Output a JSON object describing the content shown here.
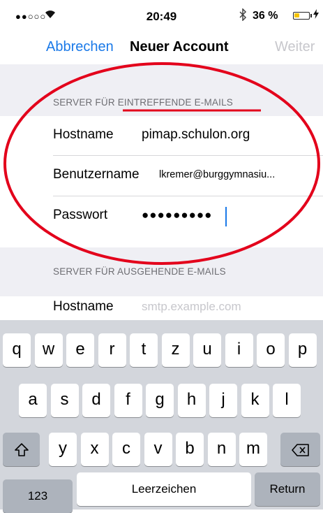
{
  "status_bar": {
    "signal": "●●○○○",
    "wifi_icon": "wifi-icon",
    "time": "20:49",
    "bluetooth_icon": "bluetooth-icon",
    "battery_text": "36 %",
    "battery_level": 0.36,
    "battery_color": "#f5c300"
  },
  "nav": {
    "cancel": "Abbrechen",
    "title": "Neuer Account",
    "next": "Weiter"
  },
  "incoming": {
    "section_title": "SERVER FÜR EINTREFFENDE E-MAILS",
    "hostname_label": "Hostname",
    "hostname_value": "pimap.schulon.org",
    "username_label": "Benutzername",
    "username_value": "lkremer@burggymnasiu...",
    "password_label": "Passwort",
    "password_value": "●●●●●●●●●"
  },
  "outgoing": {
    "section_title": "SERVER FÜR AUSGEHENDE E-MAILS",
    "hostname_label": "Hostname",
    "hostname_placeholder": "smtp.example.com"
  },
  "keyboard": {
    "row1": [
      "q",
      "w",
      "e",
      "r",
      "t",
      "z",
      "u",
      "i",
      "o",
      "p"
    ],
    "row2": [
      "a",
      "s",
      "d",
      "f",
      "g",
      "h",
      "j",
      "k",
      "l"
    ],
    "row3": [
      "y",
      "x",
      "c",
      "v",
      "b",
      "n",
      "m"
    ],
    "shift_icon": "shift-icon",
    "delete_icon": "delete-icon",
    "numbers": "123",
    "space": "Leerzeichen",
    "return": "Return"
  },
  "colors": {
    "accent": "#1a79e8",
    "annotation": "#e3001b"
  }
}
